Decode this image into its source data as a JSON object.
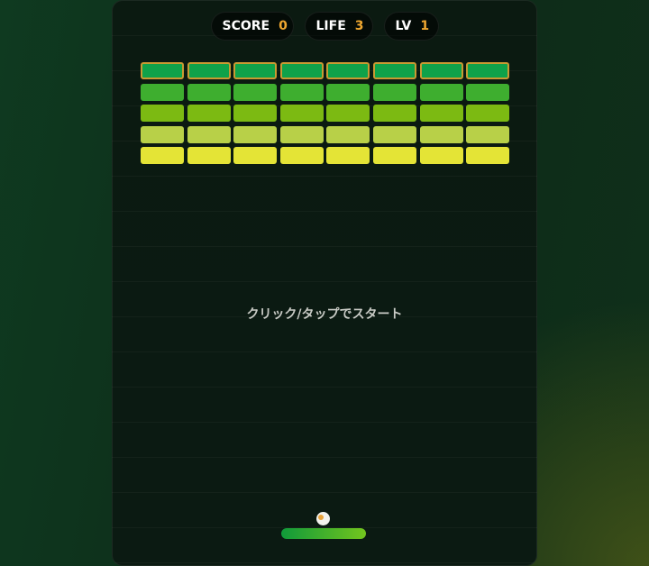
{
  "hud": {
    "score_label": "SCORE",
    "score_value": "0",
    "life_label": "LIFE",
    "life_value": "3",
    "level_label": "LV",
    "level_value": "1"
  },
  "message": "クリック/タップでスタート",
  "bricks": {
    "rows": 5,
    "cols": 8,
    "row_colors": [
      "#0fa24a",
      "#3eae2f",
      "#7cba12",
      "#b8d048",
      "#e4e436"
    ],
    "top_row_border": "#c89a32"
  },
  "colors": {
    "accent": "#f0a830",
    "paddle_start": "#109a3a",
    "paddle_end": "#73c51e",
    "ball": "#f2f2ee",
    "ball_dot": "#e8a23a"
  }
}
